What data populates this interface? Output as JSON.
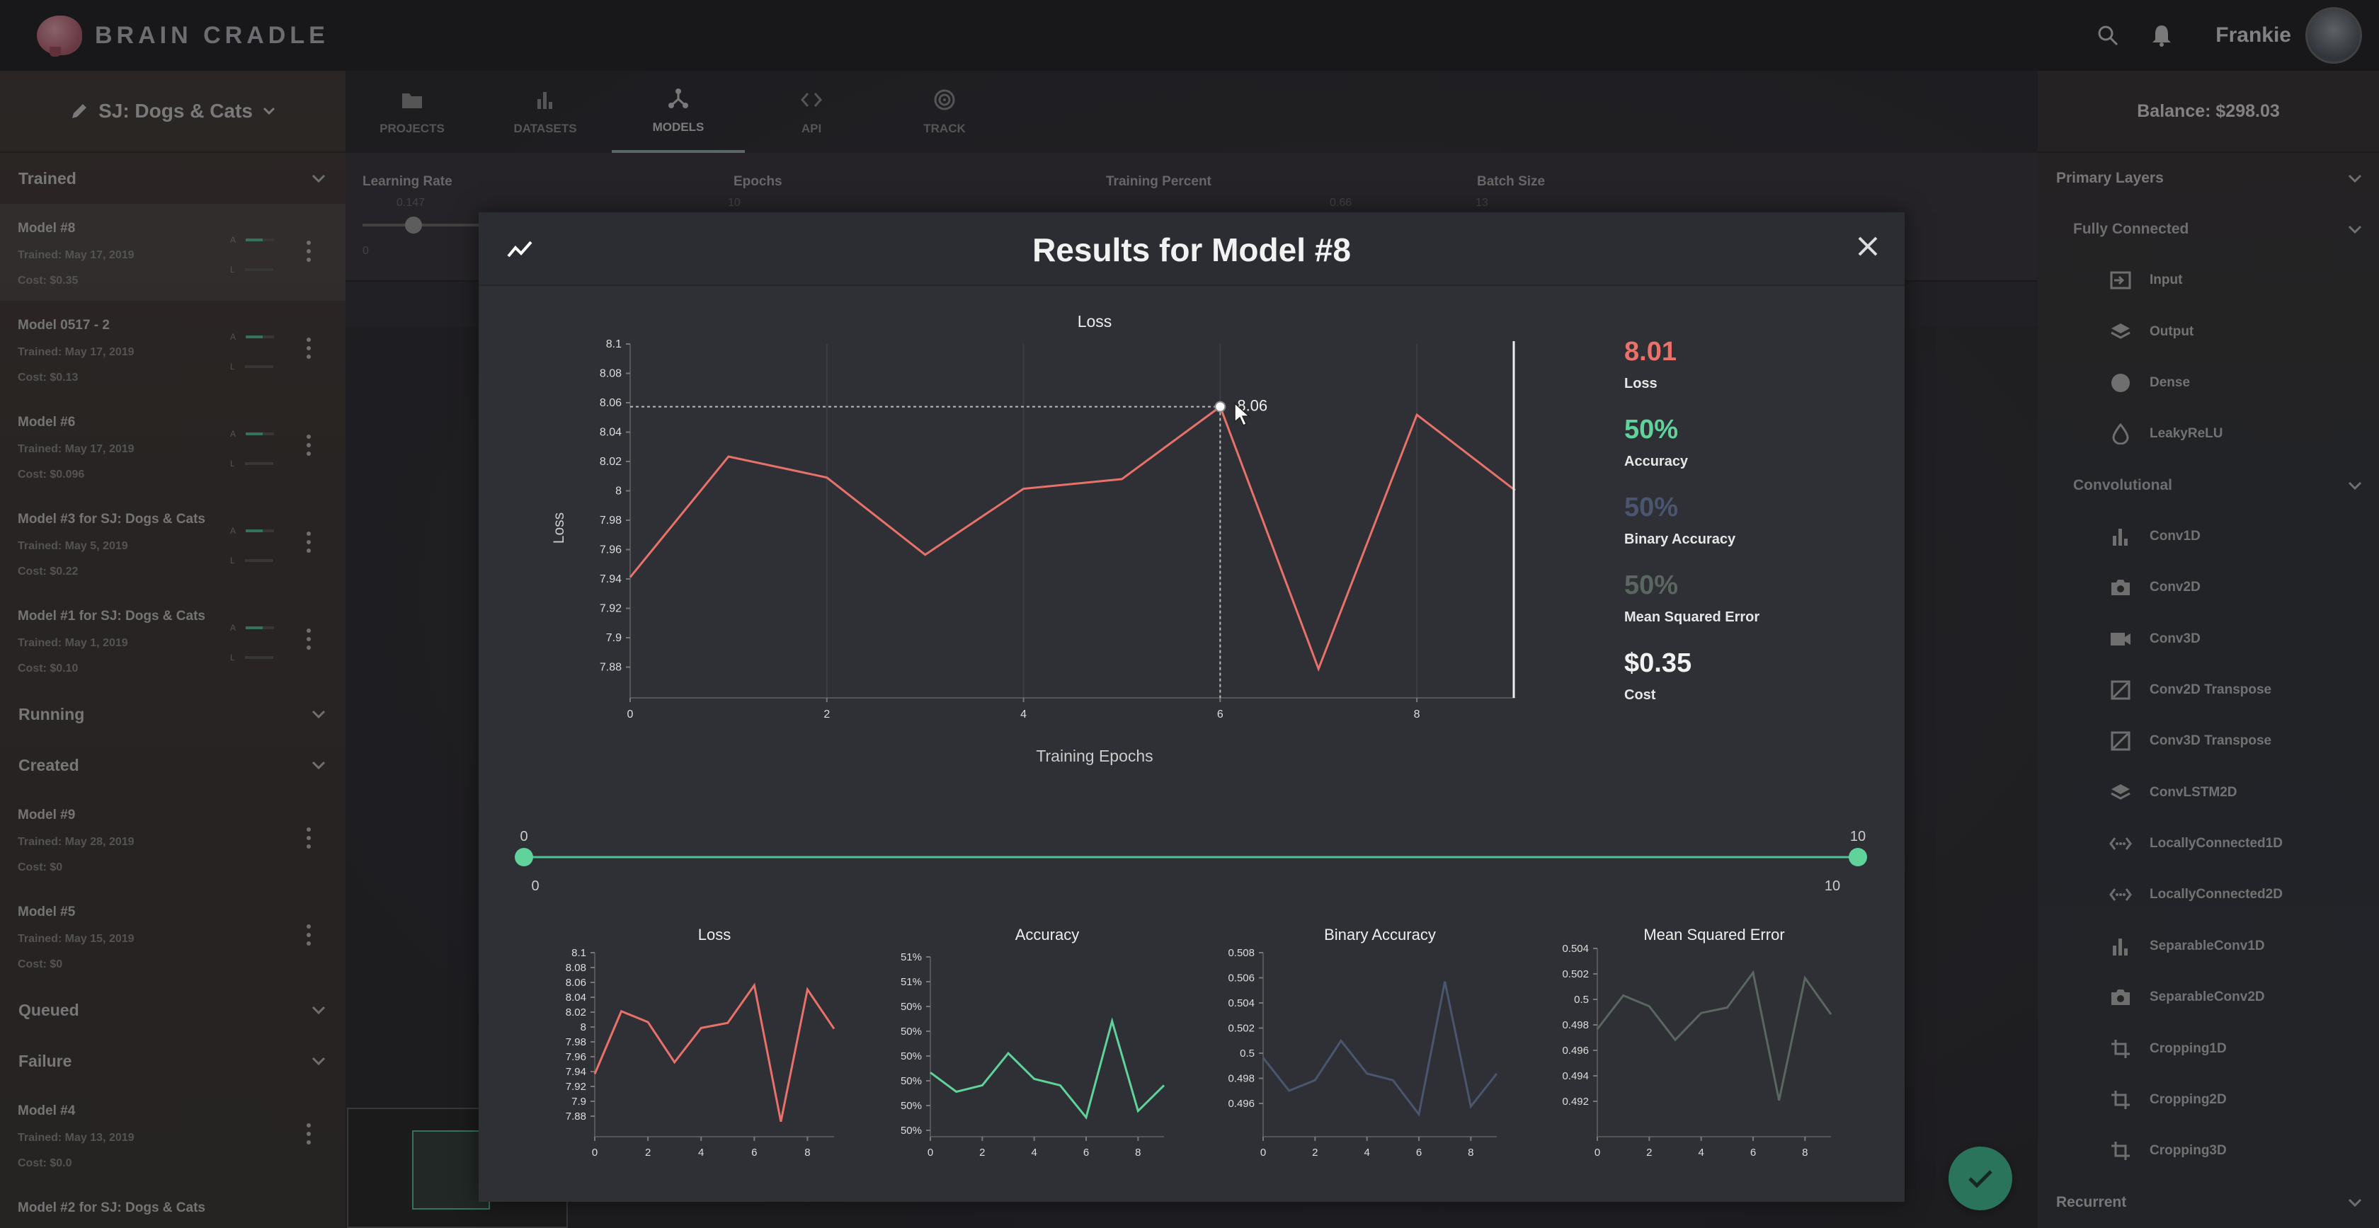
{
  "app": {
    "name": "BRAIN CRADLE",
    "user": "Frankie"
  },
  "project": {
    "name": "SJ: Dogs & Cats"
  },
  "nav": {
    "tabs": [
      {
        "label": "PROJECTS",
        "icon": "folder-icon"
      },
      {
        "label": "DATASETS",
        "icon": "bar-chart-icon"
      },
      {
        "label": "MODELS",
        "icon": "network-icon"
      },
      {
        "label": "API",
        "icon": "code-icon"
      },
      {
        "label": "TRACK",
        "icon": "radar-icon"
      }
    ],
    "active": "MODELS"
  },
  "settings": {
    "learning_rate": {
      "label": "Learning Rate",
      "value": "0.147"
    },
    "epochs": {
      "label": "Epochs",
      "value": "10"
    },
    "training_percent": {
      "label": "Training Percent",
      "value": "0.66"
    },
    "batch_size": {
      "label": "Batch Size",
      "value": "13"
    },
    "lr_min": "0"
  },
  "sidebar": {
    "sections": {
      "trained": "Trained",
      "running": "Running",
      "created": "Created",
      "queued": "Queued",
      "failure": "Failure"
    },
    "trained": [
      {
        "name": "Model #8",
        "trained": "Trained: May 17, 2019",
        "cost": "Cost: $0.35"
      },
      {
        "name": "Model 0517 - 2",
        "trained": "Trained: May 17, 2019",
        "cost": "Cost: $0.13"
      },
      {
        "name": "Model #6",
        "trained": "Trained: May 17, 2019",
        "cost": "Cost: $0.096"
      },
      {
        "name": "Model #3 for SJ: Dogs & Cats",
        "trained": "Trained: May 5, 2019",
        "cost": "Cost: $0.22"
      },
      {
        "name": "Model #1 for SJ: Dogs & Cats",
        "trained": "Trained: May 1, 2019",
        "cost": "Cost: $0.10"
      }
    ],
    "created": [
      {
        "name": "Model #9",
        "trained": "Trained: May 28, 2019",
        "cost": "Cost: $0"
      },
      {
        "name": "Model #5",
        "trained": "Trained: May 15, 2019",
        "cost": "Cost: $0"
      }
    ],
    "failure": [
      {
        "name": "Model #4",
        "trained": "Trained: May 13, 2019",
        "cost": "Cost: $0.0"
      },
      {
        "name": "Model #2 for SJ: Dogs & Cats",
        "trained": "",
        "cost": ""
      }
    ],
    "mini_labels": {
      "a": "A",
      "l": "L"
    }
  },
  "right_panel": {
    "balance": "Balance: $298.03",
    "primary_layers": "Primary Layers",
    "fully_connected": "Fully Connected",
    "fc_layers": [
      {
        "label": "Input",
        "icon": "input-icon"
      },
      {
        "label": "Output",
        "icon": "layers-icon"
      },
      {
        "label": "Dense",
        "icon": "circle-icon"
      },
      {
        "label": "LeakyReLU",
        "icon": "drop-icon"
      }
    ],
    "convolutional": "Convolutional",
    "conv_layers": [
      {
        "label": "Conv1D",
        "icon": "bar-chart-icon"
      },
      {
        "label": "Conv2D",
        "icon": "camera-icon"
      },
      {
        "label": "Conv3D",
        "icon": "video-icon"
      },
      {
        "label": "Conv2D Transpose",
        "icon": "image-icon"
      },
      {
        "label": "Conv3D Transpose",
        "icon": "image-icon"
      },
      {
        "label": "ConvLSTM2D",
        "icon": "layers-icon"
      },
      {
        "label": "LocallyConnected1D",
        "icon": "code-dots-icon"
      },
      {
        "label": "LocallyConnected2D",
        "icon": "code-dots-icon"
      },
      {
        "label": "SeparableConv1D",
        "icon": "bar-chart-icon"
      },
      {
        "label": "SeparableConv2D",
        "icon": "camera-icon"
      },
      {
        "label": "Cropping1D",
        "icon": "crop-icon"
      },
      {
        "label": "Cropping2D",
        "icon": "crop-icon"
      },
      {
        "label": "Cropping3D",
        "icon": "crop-icon"
      }
    ],
    "recurrent": "Recurrent"
  },
  "modal": {
    "title": "Results for Model #8",
    "stats": [
      {
        "value": "8.01",
        "label": "Loss",
        "color": "#e8716a"
      },
      {
        "value": "50%",
        "label": "Accuracy",
        "color": "#5fd39a"
      },
      {
        "value": "50%",
        "label": "Binary Accuracy",
        "color": "#4a5670"
      },
      {
        "value": "50%",
        "label": "Mean Squared Error",
        "color": "#5a6660"
      },
      {
        "value": "$0.35",
        "label": "Cost",
        "color": "#f2f2f2"
      }
    ],
    "tooltip_value": "8.06",
    "range": {
      "min": "0",
      "max": "10",
      "left_value": "0",
      "right_value": "10"
    }
  },
  "chart_data": [
    {
      "type": "line",
      "title": "Loss",
      "xlabel": "Training Epochs",
      "ylabel": "Loss",
      "x": [
        0,
        1,
        2,
        3,
        4,
        5,
        6,
        7,
        8,
        9
      ],
      "series": [
        {
          "values": [
            7.955,
            8.03,
            8.017,
            7.969,
            8.01,
            8.016,
            8.061,
            7.898,
            8.056,
            8.009
          ],
          "color": "#e8716a"
        }
      ],
      "yticks": [
        "8.1",
        "8.08",
        "8.06",
        "8.04",
        "8.02",
        "8",
        "7.98",
        "7.96",
        "7.94",
        "7.92",
        "7.9",
        "7.88"
      ],
      "xticks": [
        "0",
        "2",
        "4",
        "6",
        "8"
      ],
      "ylim": [
        7.88,
        8.1
      ],
      "xlim": [
        0,
        9
      ],
      "highlight": {
        "x": 6,
        "y": 8.061
      }
    },
    {
      "type": "line",
      "title": "Loss",
      "x": [
        0,
        1,
        2,
        3,
        4,
        5,
        6,
        7,
        8,
        9
      ],
      "series": [
        {
          "values": [
            7.955,
            8.03,
            8.017,
            7.969,
            8.01,
            8.016,
            8.061,
            7.898,
            8.056,
            8.009
          ],
          "color": "#e8716a"
        }
      ],
      "yticks": [
        "8.1",
        "8.08",
        "8.06",
        "8.04",
        "8.02",
        "8",
        "7.98",
        "7.96",
        "7.94",
        "7.92",
        "7.9",
        "7.88"
      ],
      "xticks": [
        "0",
        "2",
        "4",
        "6",
        "8"
      ],
      "ylim": [
        7.88,
        8.1
      ],
      "xlim": [
        0,
        9
      ]
    },
    {
      "type": "line",
      "title": "Accuracy",
      "x": [
        0,
        1,
        2,
        3,
        4,
        5,
        6,
        7,
        8,
        9
      ],
      "series": [
        {
          "values": [
            0.499,
            0.4975,
            0.498,
            0.5005,
            0.4985,
            0.498,
            0.4955,
            0.503,
            0.496,
            0.498
          ],
          "color": "#5fd39a"
        }
      ],
      "yticks": [
        "51%",
        "51%",
        "50%",
        "50%",
        "50%",
        "50%",
        "50%",
        "50%"
      ],
      "xticks": [
        "0",
        "2",
        "4",
        "6",
        "8"
      ],
      "ylim": [
        0.494,
        0.508
      ],
      "xlim": [
        0,
        9
      ]
    },
    {
      "type": "line",
      "title": "Binary Accuracy",
      "x": [
        0,
        1,
        2,
        3,
        4,
        5,
        6,
        7,
        8,
        9
      ],
      "series": [
        {
          "values": [
            0.5015,
            0.499,
            0.4998,
            0.5028,
            0.5003,
            0.4998,
            0.4972,
            0.5073,
            0.4978,
            0.5003
          ],
          "color": "#4a5670"
        }
      ],
      "yticks": [
        "0.508",
        "0.506",
        "0.504",
        "0.502",
        "0.5",
        "0.498",
        "0.496"
      ],
      "xticks": [
        "0",
        "2",
        "4",
        "6",
        "8"
      ],
      "ylim": [
        0.4955,
        0.5095
      ],
      "xlim": [
        0,
        9
      ]
    },
    {
      "type": "line",
      "title": "Mean Squared Error",
      "x": [
        0,
        1,
        2,
        3,
        4,
        5,
        6,
        7,
        8,
        9
      ],
      "series": [
        {
          "values": [
            0.4985,
            0.501,
            0.5002,
            0.4977,
            0.4997,
            0.5001,
            0.5027,
            0.4932,
            0.5023,
            0.4996
          ],
          "color": "#5a6660"
        }
      ],
      "yticks": [
        "0.504",
        "0.502",
        "0.5",
        "0.498",
        "0.496",
        "0.494",
        "0.492"
      ],
      "xticks": [
        "0",
        "2",
        "4",
        "6",
        "8"
      ],
      "ylim": [
        0.4905,
        0.5045
      ],
      "xlim": [
        0,
        9
      ]
    }
  ]
}
